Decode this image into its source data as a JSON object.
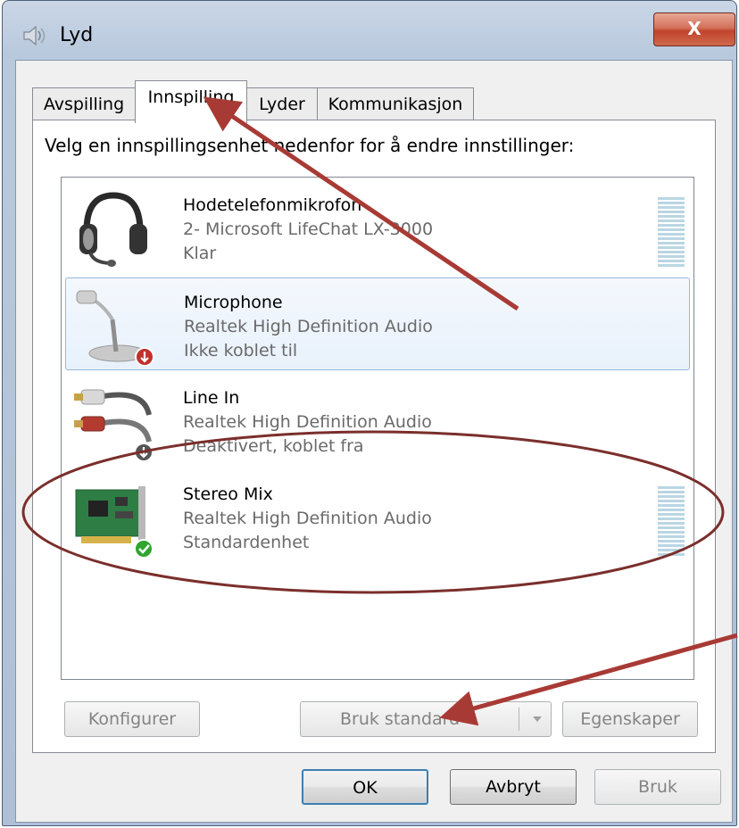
{
  "window": {
    "title": "Lyd",
    "close_label": "X"
  },
  "tabs": [
    {
      "label": "Avspilling",
      "active": false
    },
    {
      "label": "Innspilling",
      "active": true
    },
    {
      "label": "Lyder",
      "active": false
    },
    {
      "label": "Kommunikasjon",
      "active": false
    }
  ],
  "instruction": "Velg en innspillingsenhet nedenfor for å endre innstillinger:",
  "devices": [
    {
      "name": "Hodetelefonmikrofon",
      "driver": "2- Microsoft LifeChat LX-3000",
      "status": "Klar",
      "icon": "headset-icon",
      "badge": "none"
    },
    {
      "name": "Microphone",
      "driver": "Realtek High Definition Audio",
      "status": "Ikke koblet til",
      "icon": "microphone-icon",
      "badge": "unplugged"
    },
    {
      "name": "Line In",
      "driver": "Realtek High Definition Audio",
      "status": "Deaktivert, koblet fra",
      "icon": "line-in-cable-icon",
      "badge": "disabled"
    },
    {
      "name": "Stereo Mix",
      "driver": "Realtek High Definition Audio",
      "status": "Standardenhet",
      "icon": "sound-card-icon",
      "badge": "default-check"
    }
  ],
  "buttons": {
    "configure": "Konfigurer",
    "set_default": "Bruk standard",
    "properties": "Egenskaper",
    "ok": "OK",
    "cancel": "Avbryt",
    "apply": "Bruk"
  },
  "colors": {
    "annotation": "#a83a35",
    "selection_border": "#99b8dc",
    "close_button": "#c1432c",
    "default_check": "#2fa42f",
    "warning_badge": "#c0302a"
  }
}
